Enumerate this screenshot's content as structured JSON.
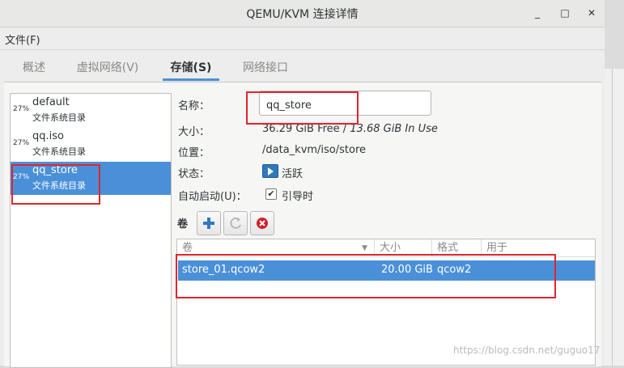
{
  "window": {
    "title": "QEMU/KVM 连接详情",
    "minimize": "_",
    "maximize": "□",
    "close": "✕"
  },
  "menu": {
    "file": "文件(F)"
  },
  "tabs": [
    "概述",
    "虚拟网络(V)",
    "存储(S)",
    "网络接口"
  ],
  "active_tab": 2,
  "pools": [
    {
      "pct": "27%",
      "name": "default",
      "type": "文件系统目录"
    },
    {
      "pct": "27%",
      "name": "qq.iso",
      "type": "文件系统目录"
    },
    {
      "pct": "27%",
      "name": "qq_store",
      "type": "文件系统目录",
      "selected": true
    }
  ],
  "details": {
    "name_label": "名称：",
    "name_value": "qq_store",
    "size_label": "大小：",
    "size_free": "36.29 GiB Free",
    "size_sep": " / ",
    "size_used": "13.68 GiB In Use",
    "location_label": "位置：",
    "location_value": "/data_kvm/iso/store",
    "state_label": "状态：",
    "state_value": "活跃",
    "autostart_label": "自动启动(U)：",
    "autostart_value": "引导时",
    "autostart_checked": true
  },
  "volumes": {
    "label": "卷",
    "columns": [
      "卷",
      "大小",
      "格式",
      "用于"
    ],
    "rows": [
      {
        "name": "store_01.qcow2",
        "size": "20.00 GiB",
        "format": "qcow2",
        "used_by": ""
      }
    ]
  },
  "watermark": "https://blog.csdn.net/guguo17",
  "colors": {
    "selection": "#4a90d9",
    "annotation": "#e0262c",
    "add": "#2f79bd",
    "delete": "#d0212a"
  },
  "icons": {
    "state": "play-icon",
    "add": "plus-icon",
    "refresh": "refresh-icon",
    "delete": "delete-icon"
  }
}
